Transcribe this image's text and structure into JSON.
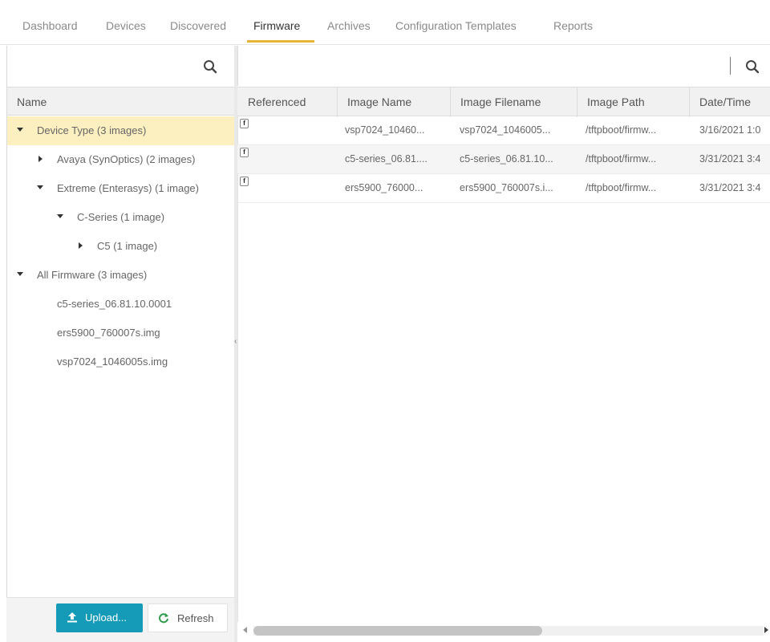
{
  "tabs": [
    {
      "label": "Dashboard"
    },
    {
      "label": "Devices"
    },
    {
      "label": "Discovered"
    },
    {
      "label": "Firmware",
      "active": true
    },
    {
      "label": "Archives"
    },
    {
      "label": "Configuration Templates"
    },
    {
      "label": "Reports"
    }
  ],
  "colors": {
    "accent": "#e8b33a",
    "primary_button": "#159ab7",
    "selected_row": "#fcefc0"
  },
  "left_panel": {
    "search_icon": "search-icon",
    "column_header": "Name",
    "tree": [
      {
        "label": "Device Type (3 images)",
        "expanded": true,
        "selected": true
      },
      {
        "label": "Avaya (SynOptics) (2 images)",
        "expanded": false
      },
      {
        "label": "Extreme (Enterasys) (1 image)",
        "expanded": true
      },
      {
        "label": "C-Series (1 image)",
        "expanded": true
      },
      {
        "label": "C5 (1 image)",
        "expanded": false
      },
      {
        "label": "All Firmware (3 images)",
        "expanded": true
      },
      {
        "label": "c5-series_06.81.10.0001"
      },
      {
        "label": "ers5900_760007s.img"
      },
      {
        "label": "vsp7024_1046005s.img"
      }
    ],
    "buttons": {
      "upload": "Upload...",
      "refresh": "Refresh"
    }
  },
  "grid": {
    "search_icon": "search-icon",
    "columns": [
      "Referenced",
      "Image Name",
      "Image Filename",
      "Image Path",
      "Date/Time"
    ],
    "rows": [
      {
        "referenced_icon": "f",
        "image_name": "vsp7024_10460...",
        "image_filename": "vsp7024_1046005...",
        "image_path": "/tftpboot/firmw...",
        "date_time": "3/16/2021 1:0"
      },
      {
        "referenced_icon": "f",
        "image_name": "c5-series_06.81....",
        "image_filename": "c5-series_06.81.10...",
        "image_path": "/tftpboot/firmw...",
        "date_time": "3/31/2021 3:4"
      },
      {
        "referenced_icon": "f",
        "image_name": "ers5900_76000...",
        "image_filename": "ers5900_760007s.i...",
        "image_path": "/tftpboot/firmw...",
        "date_time": "3/31/2021 3:4"
      }
    ]
  }
}
